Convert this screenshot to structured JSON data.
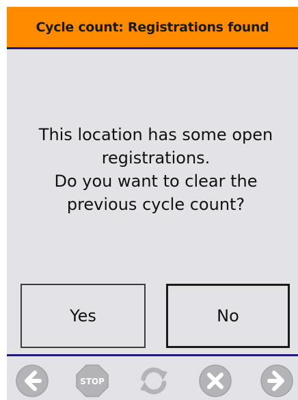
{
  "header": {
    "title": "Cycle count: Registrations found"
  },
  "dialog": {
    "message": "This location has some open\nregistrations.\nDo you want to clear the\nprevious cycle count?",
    "yes_label": "Yes",
    "no_label": "No"
  },
  "footer": {
    "icons": [
      "back-arrow-icon",
      "stop-icon",
      "refresh-icon",
      "cancel-icon",
      "forward-arrow-icon"
    ],
    "stop_label": "STOP"
  },
  "colors": {
    "header_bg": "#ff8c00",
    "divider": "#1a1a78",
    "panel_bg": "#e3e2e7",
    "icon_gray": "#b4b4b8"
  }
}
